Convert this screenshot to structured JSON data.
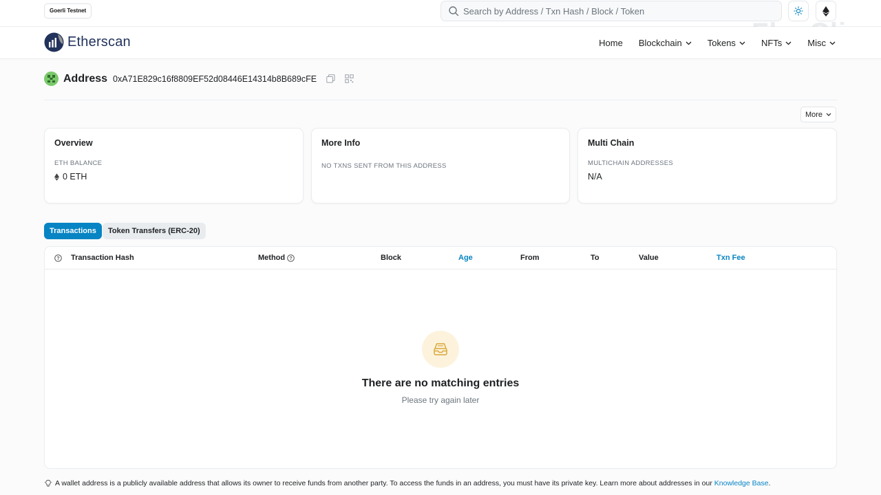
{
  "topbar": {
    "network_badge": "Goerli Testnet",
    "search_placeholder": "Search by Address / Txn Hash / Block / Token",
    "watermark": "FlexClip"
  },
  "navbar": {
    "brand": "Etherscan",
    "menu": [
      {
        "label": "Home",
        "dropdown": false
      },
      {
        "label": "Blockchain",
        "dropdown": true
      },
      {
        "label": "Tokens",
        "dropdown": true
      },
      {
        "label": "NFTs",
        "dropdown": true
      },
      {
        "label": "Misc",
        "dropdown": true
      }
    ]
  },
  "address": {
    "title": "Address",
    "hash": "0xA71E829c16f8809EF52d08446E14314b8B689cFE"
  },
  "more_button": "More",
  "cards": {
    "overview": {
      "title": "Overview",
      "label": "ETH BALANCE",
      "value": "0 ETH"
    },
    "more_info": {
      "title": "More Info",
      "label": "NO TXNS SENT FROM THIS ADDRESS"
    },
    "multi_chain": {
      "title": "Multi Chain",
      "label": "MULTICHAIN ADDRESSES",
      "value": "N/A"
    }
  },
  "tabs": {
    "transactions": "Transactions",
    "token_transfers": "Token Transfers (ERC-20)"
  },
  "table": {
    "headers": {
      "txn_hash": "Transaction Hash",
      "method": "Method",
      "block": "Block",
      "age": "Age",
      "from": "From",
      "to": "To",
      "value": "Value",
      "txn_fee": "Txn Fee"
    },
    "empty_title": "There are no matching entries",
    "empty_subtitle": "Please try again later"
  },
  "footer_note": {
    "text": "A wallet address is a publicly available address that allows its owner to receive funds from another party. To access the funds in an address, you must have its private key. Learn more about addresses in our",
    "link": "Knowledge Base",
    "end": "."
  },
  "colors": {
    "accent": "#0784c3",
    "brand_dark": "#21325b",
    "empty_icon_bg": "#fdf3dd",
    "empty_icon": "#d9a83a"
  }
}
